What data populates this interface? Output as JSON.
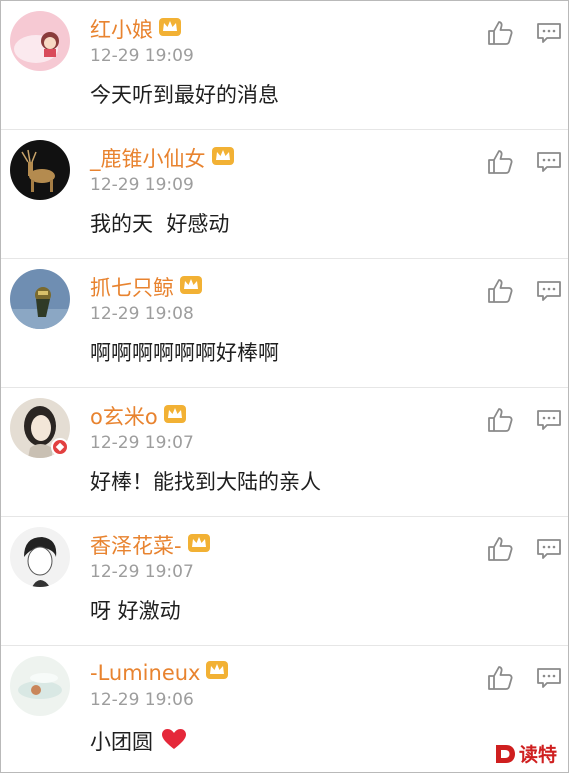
{
  "comments": [
    {
      "username": "红小娘",
      "time": "12-29 19:09",
      "text": "今天听到最好的消息",
      "avatar_icon": "cartoon-girl-avatar-icon"
    },
    {
      "username": "_鹿锥小仙女",
      "time": "12-29 19:09",
      "text": "我的天  好感动",
      "avatar_icon": "deer-avatar-icon"
    },
    {
      "username": "抓七只鲸",
      "time": "12-29 19:08",
      "text": "啊啊啊啊啊啊好棒啊",
      "avatar_icon": "figure-avatar-icon"
    },
    {
      "username": "o玄米o",
      "time": "12-29 19:07",
      "text": "好棒！能找到大陆的亲人",
      "avatar_icon": "portrait-avatar-icon",
      "verified": true
    },
    {
      "username": "香泽花菜-",
      "time": "12-29 19:07",
      "text": "呀 好激动",
      "avatar_icon": "sketch-boy-avatar-icon"
    },
    {
      "username": "-Lumineux",
      "time": "12-29 19:06",
      "text": "小团圆",
      "avatar_icon": "light-avatar-icon",
      "emoji": "heart"
    }
  ],
  "icons": {
    "like": "thumbs-up-icon",
    "reply": "comment-icon",
    "member": "crown-icon"
  },
  "colors": {
    "username": "#e8832f",
    "timestamp": "#9d9d9d",
    "text": "#1f1f1f",
    "heart": "#e5283a",
    "watermark": "#cf1f1f"
  },
  "watermark": {
    "text": "读特"
  }
}
